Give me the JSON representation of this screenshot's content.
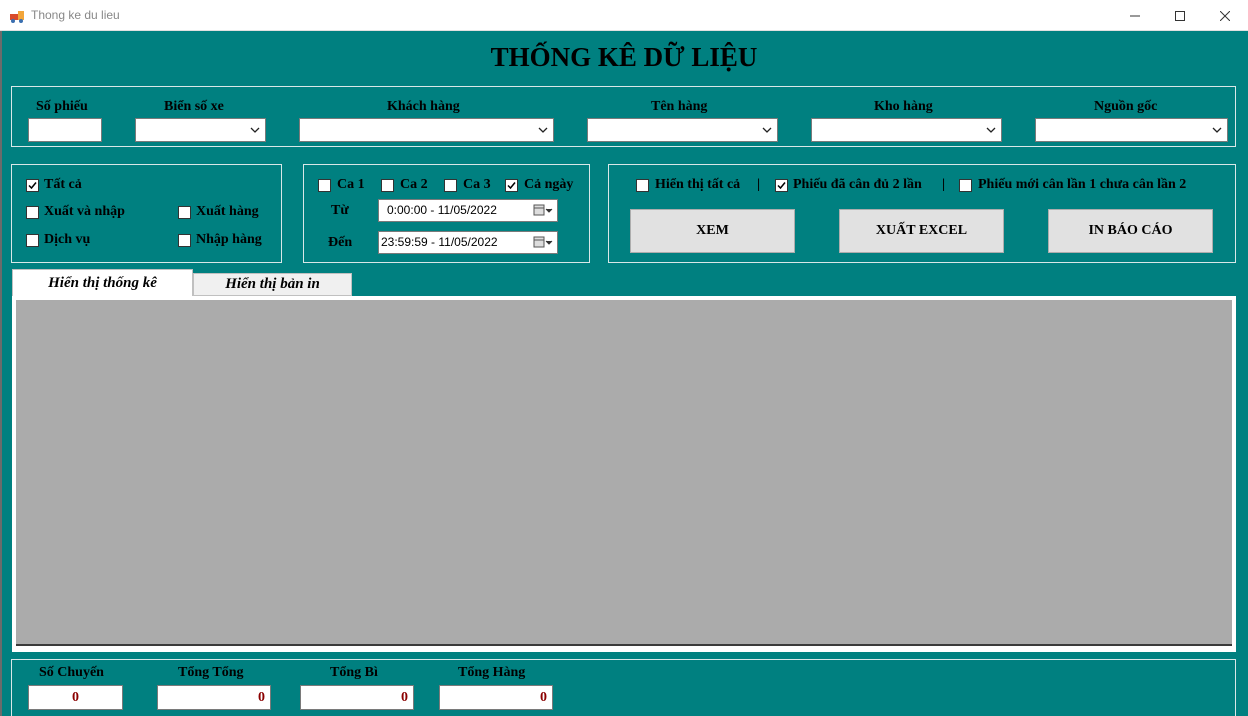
{
  "window": {
    "title": "Thong ke du lieu",
    "controls": {
      "minimize": "—",
      "maximize": "☐",
      "close": "✕"
    },
    "icon": "app-icon"
  },
  "header": {
    "title": "THỐNG KÊ DỮ LIỆU"
  },
  "filters": {
    "so_phieu": {
      "label": "Số phiếu",
      "value": ""
    },
    "bien_so_xe": {
      "label": "Biển số xe",
      "value": ""
    },
    "khach_hang": {
      "label": "Khách hàng",
      "value": ""
    },
    "ten_hang": {
      "label": "Tên hàng",
      "value": ""
    },
    "kho_hang": {
      "label": "Kho hàng",
      "value": ""
    },
    "nguon_goc": {
      "label": "Nguồn gốc",
      "value": ""
    }
  },
  "type_group": {
    "tat_ca": {
      "label": "Tất cả",
      "checked": true
    },
    "xuat_va_nhap": {
      "label": "Xuất và nhập",
      "checked": false
    },
    "xuat_hang": {
      "label": "Xuất hàng",
      "checked": false
    },
    "dich_vu": {
      "label": "Dịch vụ",
      "checked": false
    },
    "nhap_hang": {
      "label": "Nhập hàng",
      "checked": false
    }
  },
  "shift_group": {
    "ca1": {
      "label": "Ca 1",
      "checked": false
    },
    "ca2": {
      "label": "Ca 2",
      "checked": false
    },
    "ca3": {
      "label": "Ca 3",
      "checked": false
    },
    "ca_ngay": {
      "label": "Cả ngày",
      "checked": true
    },
    "tu": {
      "label": "Từ",
      "value": "0:00:00 - 11/05/2022"
    },
    "den": {
      "label": "Đến",
      "value": "23:59:59 - 11/05/2022"
    }
  },
  "display_group": {
    "hien_thi_tat_ca": {
      "label": "Hiển thị tất cả",
      "checked": false
    },
    "separator": "|",
    "phieu_da_can": {
      "label": "Phiếu đã cân đủ 2 lần",
      "checked": true
    },
    "phieu_moi_can": {
      "label": "Phiếu mới cân lần 1 chưa cân lần 2",
      "checked": false
    },
    "buttons": {
      "xem": "XEM",
      "xuat_excel": "XUẤT EXCEL",
      "in_bao_cao": "IN BÁO CÁO"
    }
  },
  "tabs": [
    {
      "label": "Hiển thị thống kê",
      "active": true
    },
    {
      "label": "Hiển thị bản in",
      "active": false
    }
  ],
  "summary": {
    "so_chuyen": {
      "label": "Số Chuyến",
      "value": "0"
    },
    "tong_tong": {
      "label": "Tổng Tổng",
      "value": "0"
    },
    "tong_bi": {
      "label": "Tổng Bì",
      "value": "0"
    },
    "tong_hang": {
      "label": "Tổng Hàng",
      "value": "0"
    }
  },
  "colors": {
    "background": "#008080",
    "value_text": "#8b0000",
    "grid": "#ababab"
  }
}
